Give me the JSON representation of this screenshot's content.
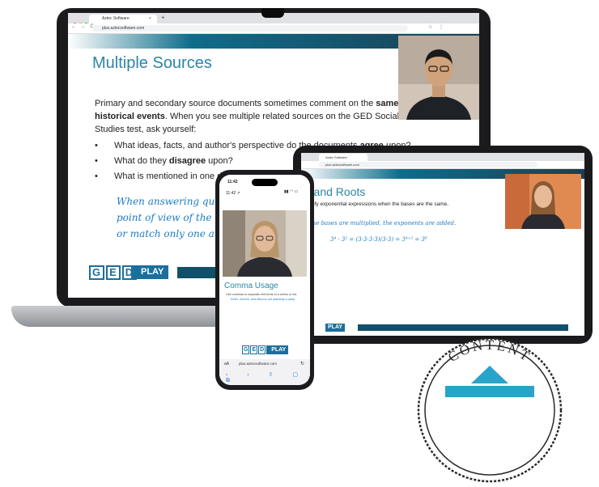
{
  "laptop": {
    "browser": {
      "tab_title": "Aztec Software",
      "tab_close": "×",
      "new_tab": "+",
      "url": "plus.aztecsoftware.com",
      "nav": "← → C",
      "tools": "☆ ⋮"
    },
    "slide": {
      "title": "Multiple Sources",
      "intro_part1": "Primary and secondary source documents sometimes comment on the ",
      "intro_bold1": "same historical events",
      "intro_part2": ". When you see multiple related sources on the GED Social Studies test, ask yourself:",
      "bullets": [
        {
          "marker": "•",
          "pre": "What ideas, facts, and author's perspective do the documents ",
          "bold": "agree",
          "post": " upon?"
        },
        {
          "marker": "•",
          "pre": "What do they ",
          "bold": "disagree",
          "post": " upon?"
        },
        {
          "marker": "•",
          "pre": "What is mentioned in one do",
          "bold": "",
          "post": ""
        }
      ],
      "handwriting": [
        "When answering questi",
        "point of view of the tw",
        "or match only one auth"
      ]
    },
    "logo": {
      "g": "G",
      "e": "E",
      "d": "D",
      "play": "PLAY"
    }
  },
  "tablet": {
    "browser": {
      "tab_title": "Aztec Software",
      "url": "plus.aztecsoftware.com"
    },
    "slide": {
      "title": "rs and Roots",
      "text1": "simplify exponential expressions when the bases are the same.",
      "text2": "en the bases are multiplied, the exponents are added.",
      "math": "3⁴ · 3² = (3·3·3·3)(3·3) = 3⁴⁺² = 3⁶"
    },
    "logo_play": "PLAY"
  },
  "phone": {
    "time": "11:42",
    "time2": "11:42 ↗",
    "status_icons": "▮▮ ◠ ▭",
    "slide": {
      "title": "Comma Usage",
      "text1": "Use commas to separate elements in a series or list.",
      "text2": "Keith, Darcell, and Marcus are planning a party."
    },
    "logo": {
      "g": "G",
      "e": "E",
      "d": "D",
      "play": "PLAY"
    },
    "browser": {
      "aa": "aA",
      "url": "plus.aztecsoftware.com",
      "reload": "↻",
      "nav": "‹ › ⇧ ▢ ⧉"
    }
  },
  "badge": {
    "text": "CONTENT"
  },
  "colors": {
    "brand_teal": "#2a86a8",
    "brand_blue": "#1b6f9c",
    "band_dark": "#11506a"
  }
}
